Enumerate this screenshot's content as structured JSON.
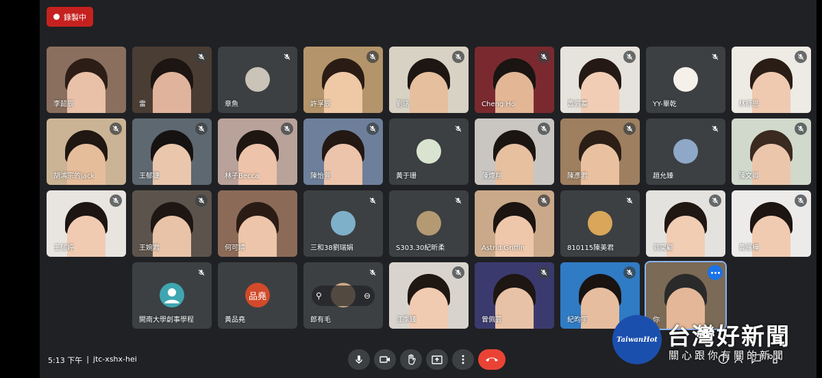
{
  "recording": {
    "label": "錄製中"
  },
  "meeting": {
    "time": "5:13 下午",
    "separator": "|",
    "code": "jtc-xshx-hei"
  },
  "tiles": [
    {
      "name": "李韶辰",
      "type": "video",
      "bg": "#8a6f5e",
      "skin": "#e8c1a8",
      "hair": "#2d1d17",
      "muted": false
    },
    {
      "name": "雷",
      "type": "video",
      "bg": "#4a3d33",
      "skin": "#e0b39c",
      "hair": "#1c1512",
      "muted": true
    },
    {
      "name": "章魚",
      "type": "avatar",
      "avatarColor": "#c9c3b8",
      "muted": true
    },
    {
      "name": "許孚辰",
      "type": "video",
      "bg": "#b4946a",
      "skin": "#efc8a6",
      "hair": "#2a1c14",
      "muted": true
    },
    {
      "name": "劉瑞",
      "type": "video",
      "bg": "#d8d2c4",
      "skin": "#e6bf9e",
      "hair": "#1d1613",
      "muted": true
    },
    {
      "name": "Cheng Ho",
      "type": "video",
      "bg": "#7a2a2f",
      "skin": "#e3b696",
      "hair": "#1a1412",
      "muted": true
    },
    {
      "name": "蕭佩蓁",
      "type": "video",
      "bg": "#e6e2dc",
      "skin": "#f0cdb4",
      "hair": "#241915",
      "muted": true
    },
    {
      "name": "YY-畢乾",
      "type": "avatar",
      "avatarColor": "#f5f0ea",
      "muted": true
    },
    {
      "name": "林祈恩",
      "type": "video",
      "bg": "#eeeae4",
      "skin": "#efcab0",
      "hair": "#2a1d16",
      "muted": true
    },
    {
      "name": "胡鴻宗的jack",
      "type": "video",
      "bg": "#cbb495",
      "skin": "#e6bd9b",
      "hair": "#201712",
      "muted": true
    },
    {
      "name": "王郁婕",
      "type": "video",
      "bg": "#5e6870",
      "skin": "#e9c6ac",
      "hair": "#161211",
      "muted": true
    },
    {
      "name": "林子Becca",
      "type": "video",
      "bg": "#b8a29a",
      "skin": "#edc3a9",
      "hair": "#1f1612",
      "muted": true
    },
    {
      "name": "陳怡萱",
      "type": "video",
      "bg": "#6d7f9a",
      "skin": "#ecc4ab",
      "hair": "#241813",
      "muted": true
    },
    {
      "name": "黃于珊",
      "type": "avatar",
      "avatarColor": "#d9e4d0",
      "muted": true
    },
    {
      "name": "陳煒翔",
      "type": "video",
      "bg": "#c9c6c2",
      "skin": "#e7c0a0",
      "hair": "#1b1512",
      "muted": true
    },
    {
      "name": "陳彥君",
      "type": "video",
      "bg": "#9e7f60",
      "skin": "#e9c1a0",
      "hair": "#2b1e16",
      "muted": true
    },
    {
      "name": "趙允臻",
      "type": "avatar",
      "avatarColor": "#8fa8c8",
      "muted": true
    },
    {
      "name": "陳文卿",
      "type": "video",
      "bg": "#d0d9cc",
      "skin": "#ecc6ab",
      "hair": "#3a2a20",
      "muted": true
    },
    {
      "name": "王郁婷",
      "type": "video",
      "bg": "#e8e4e0",
      "skin": "#f0cbb2",
      "hair": "#1d1512",
      "muted": true
    },
    {
      "name": "王婉君",
      "type": "video",
      "bg": "#5c544c",
      "skin": "#e9c3a8",
      "hair": "#1e1612",
      "muted": true
    },
    {
      "name": "何可晴",
      "type": "video",
      "bg": "#8c6a58",
      "skin": "#ecc5aa",
      "hair": "#2a1c15",
      "muted": false
    },
    {
      "name": "三和38劉瑞娟",
      "type": "avatar",
      "avatarColor": "#7fb0c9",
      "muted": true
    },
    {
      "name": "S303.30紀昕柔",
      "type": "avatar",
      "avatarColor": "#b49a72",
      "muted": true
    },
    {
      "name": "Astrid Griffin",
      "type": "video",
      "bg": "#c9a98a",
      "skin": "#eec7ab",
      "hair": "#1b1411",
      "muted": true
    },
    {
      "name": "810115陳美君",
      "type": "avatar",
      "avatarColor": "#d9a65a",
      "muted": true
    },
    {
      "name": "郭奕顧",
      "type": "video",
      "bg": "#e4e2de",
      "skin": "#f1cdb4",
      "hair": "#201713",
      "muted": true
    },
    {
      "name": "黃霈樺",
      "type": "video",
      "bg": "#ecebe9",
      "skin": "#f0cbb2",
      "hair": "#1d1512",
      "muted": true
    },
    {
      "name": "開南大學創事學程",
      "type": "person-avatar",
      "muted": true
    },
    {
      "name": "黃品堯",
      "type": "letter",
      "letter": "品堯",
      "muted": false
    },
    {
      "name": "郎有毛",
      "type": "hover",
      "avatarColor": "#caa986",
      "muted": true
    },
    {
      "name": "江季臻",
      "type": "video",
      "bg": "#d8d4cd",
      "skin": "#f0cbb1",
      "hair": "#1f1712",
      "muted": true
    },
    {
      "name": "曾佩芸",
      "type": "video",
      "bg": "#3b3a6e",
      "skin": "#e8c2a6",
      "hair": "#1e1612",
      "muted": true
    },
    {
      "name": "紀昀宇",
      "type": "video",
      "bg": "#2f7bc4",
      "skin": "#e6bd9f",
      "hair": "#191311",
      "muted": true
    },
    {
      "name": "你",
      "type": "self",
      "bg": "#7a6a56",
      "skin": "#e3b797",
      "hair": "#2a2a2a",
      "muted": false
    }
  ],
  "logo": {
    "circle": "TaiwanHot",
    "title": "台灣好新聞",
    "subtitle": "關心跟你有關的新聞"
  }
}
